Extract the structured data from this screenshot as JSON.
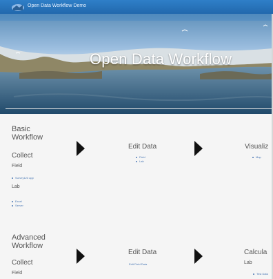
{
  "header": {
    "app_title": "Open Data Workflow Demo"
  },
  "hero": {
    "title": "Open Data Workflow"
  },
  "basic": {
    "title_line1": "Basic",
    "title_line2": "Workflow",
    "collect": "Collect",
    "field": "Field",
    "field_link": "Survey123 app",
    "lab": "Lab",
    "lab_links": [
      "Excel",
      "Server"
    ],
    "edit_data": "Edit Data",
    "edit_links": [
      "Field",
      "Lab"
    ],
    "visualize": "Visualiz",
    "visualize_links": [
      "Map"
    ]
  },
  "advanced": {
    "title_line1": "Advanced",
    "title_line2": "Workflow",
    "collect": "Collect",
    "field": "Field",
    "edit_data": "Edit Data",
    "edit_link": "Edit Field Data",
    "calculate": "Calcula",
    "lab": "Lab",
    "calc_link": "Test Data"
  },
  "colors": {
    "topbar": "#2168ad",
    "hero_sky": "#8fb7dc",
    "water": "#3d6f8f",
    "text": "#555555",
    "link": "#4a78b5"
  }
}
